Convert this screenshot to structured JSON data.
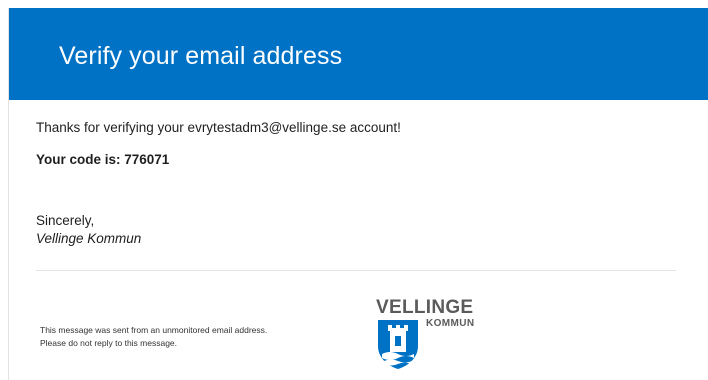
{
  "header": {
    "title": "Verify your email address",
    "background_color": "#0072c6"
  },
  "body": {
    "intro": "Thanks for verifying your evrytestadm3@vellinge.se account!",
    "code_line": "Your code is: 776071",
    "sincerely": "Sincerely,",
    "signature": "Vellinge Kommun"
  },
  "footer": {
    "note_line1": "This message was sent from an unmonitored email address.",
    "note_line2": "Please do not reply to this message."
  },
  "logo": {
    "name": "VELLINGE",
    "sub": "KOMMUN",
    "icon": "vellinge-coat-of-arms-icon",
    "shield_color": "#0072c6",
    "text_color": "#5b5b5b"
  }
}
